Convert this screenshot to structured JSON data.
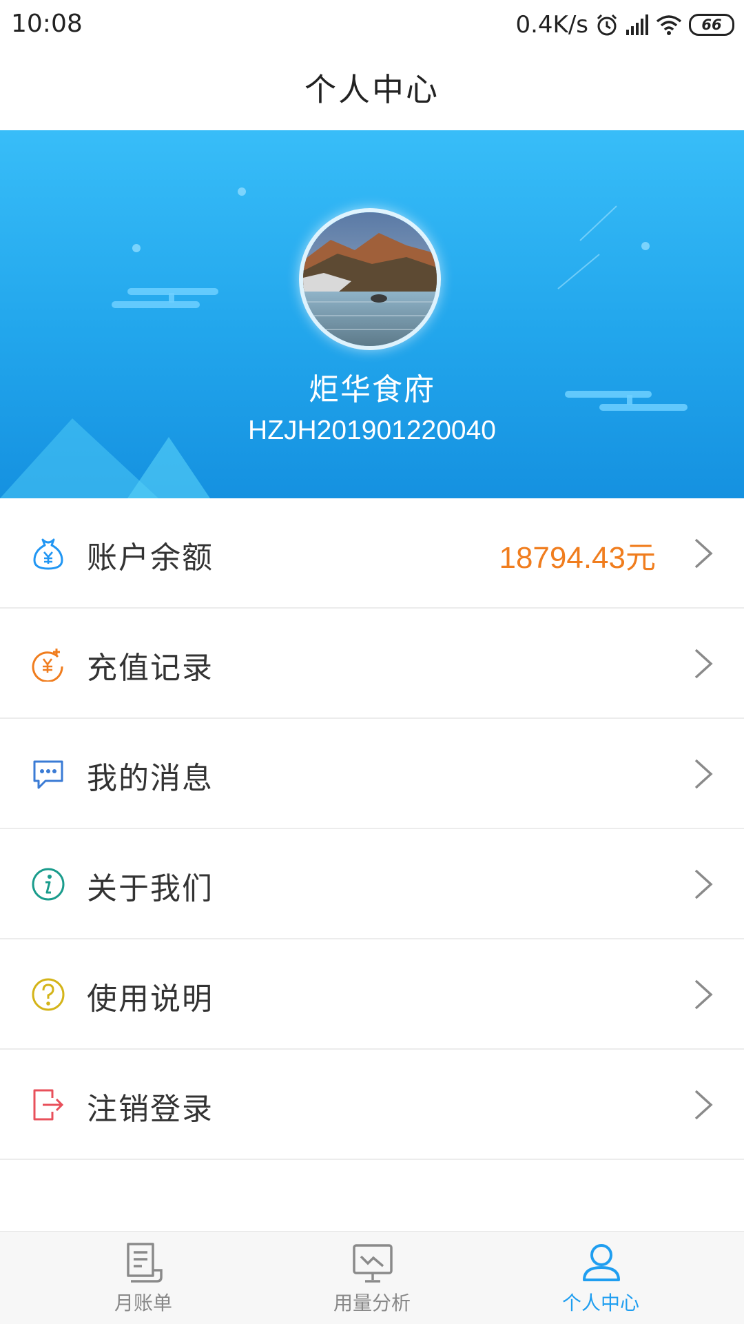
{
  "status_bar": {
    "time": "10:08",
    "net_speed": "0.4K/s",
    "battery": "66",
    "icons": [
      "alarm-icon",
      "signal-icon",
      "wifi-icon",
      "battery-icon"
    ]
  },
  "header": {
    "title": "个人中心"
  },
  "profile": {
    "name": "炬华食府",
    "account_id": "HZJH201901220040"
  },
  "menu": [
    {
      "label": "账户余额",
      "value": "18794.43元",
      "icon": "money-bag-icon",
      "icon_color": "#2196f3"
    },
    {
      "label": "充值记录",
      "value": "",
      "icon": "recharge-icon",
      "icon_color": "#f07d1e"
    },
    {
      "label": "我的消息",
      "value": "",
      "icon": "message-icon",
      "icon_color": "#3a7bd5"
    },
    {
      "label": "关于我们",
      "value": "",
      "icon": "info-icon",
      "icon_color": "#1a9c8c"
    },
    {
      "label": "使用说明",
      "value": "",
      "icon": "help-icon",
      "icon_color": "#d4b419"
    },
    {
      "label": "注销登录",
      "value": "",
      "icon": "logout-icon",
      "icon_color": "#e8505b"
    }
  ],
  "bottom_nav": [
    {
      "label": "月账单",
      "icon": "bill-icon",
      "active": false
    },
    {
      "label": "用量分析",
      "icon": "analysis-icon",
      "active": false
    },
    {
      "label": "个人中心",
      "icon": "user-icon",
      "active": true
    }
  ],
  "colors": {
    "accent": "#1f9ef0",
    "balance": "#f07d1e"
  }
}
